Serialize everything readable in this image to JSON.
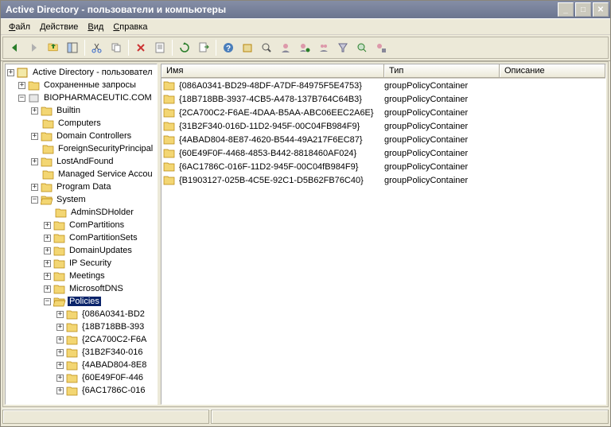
{
  "window": {
    "title": "Active Directory - пользователи и компьютеры"
  },
  "menu": {
    "file": "Файл",
    "action": "Действие",
    "view": "Вид",
    "help": "Справка"
  },
  "tree": {
    "root": "Active Directory - пользовател",
    "saved": "Сохраненные запросы",
    "domain": "BIOPHARMACEUTIC.COM",
    "builtin": "Builtin",
    "computers": "Computers",
    "dcs": "Domain Controllers",
    "fsp": "ForeignSecurityPrincipal",
    "laf": "LostAndFound",
    "msa": "Managed Service Accou",
    "pdata": "Program Data",
    "system": "System",
    "adminsd": "AdminSDHolder",
    "compart": "ComPartitions",
    "compartsets": "ComPartitionSets",
    "domupd": "DomainUpdates",
    "ipsec": "IP Security",
    "meetings": "Meetings",
    "msdns": "MicrosoftDNS",
    "policies": "Policies",
    "p1": "{086A0341-BD2",
    "p2": "{18B718BB-393",
    "p3": "{2CA700C2-F6A",
    "p4": "{31B2F340-016",
    "p5": "{4ABAD804-8E8",
    "p6": "{60E49F0F-446",
    "p7": "{6AC1786C-016"
  },
  "columns": {
    "name": "Имя",
    "type": "Тип",
    "desc": "Описание"
  },
  "items": [
    {
      "name": "{086A0341-BD29-48DF-A7DF-84975F5E4753}",
      "type": "groupPolicyContainer"
    },
    {
      "name": "{18B718BB-3937-4CB5-A478-137B764C64B3}",
      "type": "groupPolicyContainer"
    },
    {
      "name": "{2CA700C2-F6AE-4DAA-B5AA-ABC06EEC2A6E}",
      "type": "groupPolicyContainer"
    },
    {
      "name": "{31B2F340-016D-11D2-945F-00C04FB984F9}",
      "type": "groupPolicyContainer"
    },
    {
      "name": "{4ABAD804-8E87-4620-B544-49A217F6EC87}",
      "type": "groupPolicyContainer"
    },
    {
      "name": "{60E49F0F-4468-4853-B442-8818460AF024}",
      "type": "groupPolicyContainer"
    },
    {
      "name": "{6AC1786C-016F-11D2-945F-00C04fB984F9}",
      "type": "groupPolicyContainer"
    },
    {
      "name": "{B1903127-025B-4C5E-92C1-D5B62FB76C40}",
      "type": "groupPolicyContainer"
    }
  ]
}
